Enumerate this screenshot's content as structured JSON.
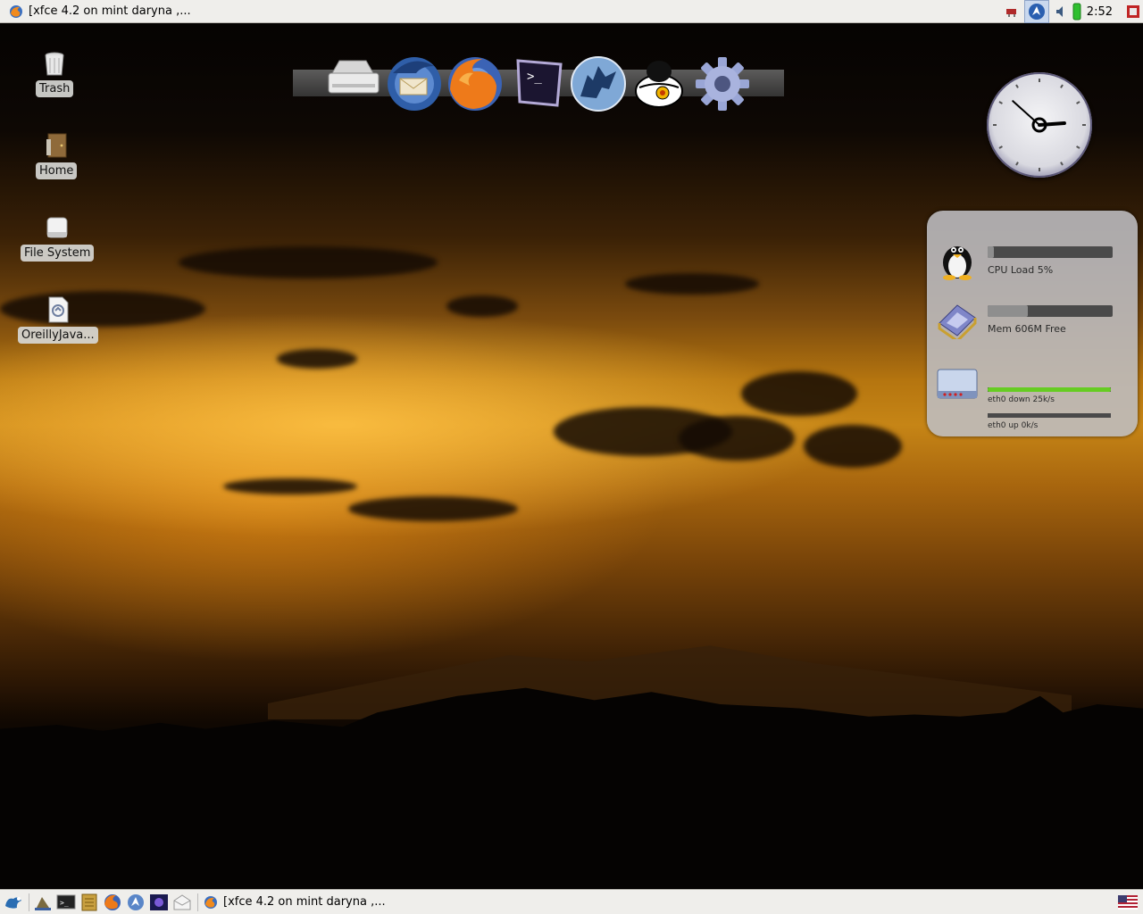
{
  "top_panel": {
    "window_task": "[xfce 4.2 on mint daryna ,...",
    "clock": "2:52",
    "tray_icons": [
      "network-icon",
      "browser-tray-icon",
      "volume-icon",
      "battery-icon",
      "power-icon"
    ]
  },
  "desktop_icons": [
    {
      "label": "Trash",
      "icon": "trash-icon"
    },
    {
      "label": "Home",
      "icon": "home-folder-icon"
    },
    {
      "label": "File System",
      "icon": "drive-icon"
    },
    {
      "label": "OreillyJava...",
      "icon": "document-icon"
    }
  ],
  "dock": {
    "items": [
      "drive-launcher-icon",
      "thunderbird-icon",
      "firefox-icon",
      "terminal-icon",
      "amarok-icon",
      "pidgin-icon",
      "settings-gear-icon"
    ]
  },
  "analog_clock": {
    "hour": 2,
    "minute": 52
  },
  "system_monitor": {
    "cpu": {
      "label": "CPU Load 5%",
      "level": 0.05
    },
    "mem": {
      "label": "Mem 606M Free",
      "level": 0.32
    },
    "net_down": {
      "label": "eth0 down 25k/s",
      "level": 1.0
    },
    "net_up": {
      "label": "eth0 up 0k/s",
      "level": 0.0
    },
    "accent_color": "#66cc22"
  },
  "bottom_panel": {
    "window_task": "[xfce 4.2 on mint daryna ,...",
    "launchers": [
      "xfce-menu-icon",
      "desktop-icon",
      "terminal-icon",
      "file-manager-icon",
      "firefox-icon",
      "browser-icon",
      "mail-icon",
      "notes-icon"
    ],
    "keyboard_layout": "us-flag-icon"
  }
}
